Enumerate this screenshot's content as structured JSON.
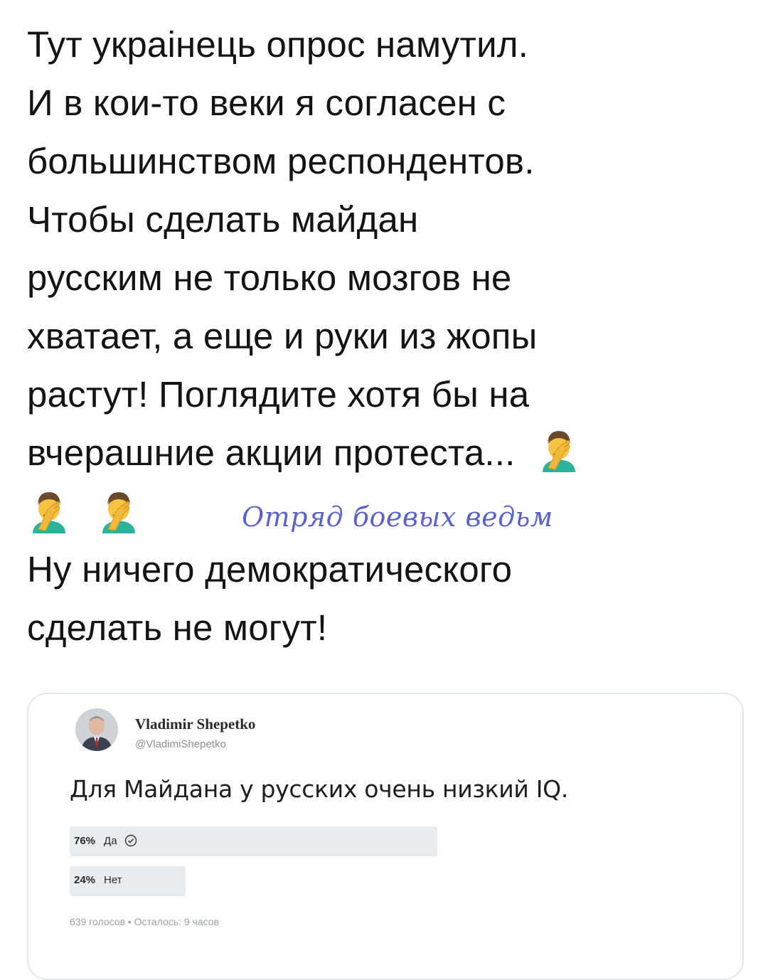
{
  "post": {
    "lines": [
      "Тут украінець опрос намутил.",
      "И в кои-то веки я согласен с",
      "большинством респондентов.",
      "Чтобы сделать майдан",
      "русским не только мозгов не",
      "хватает, а еще и руки из жопы",
      "растут! Поглядите хотя бы на",
      "вчерашние акции протеста..."
    ],
    "closing_lines": [
      "Ну ничего демократического",
      "сделать не могут!"
    ],
    "emoji_name": "facepalm-emoji"
  },
  "watermark": {
    "text": "Отряд боевых ведьм",
    "color": "#5a63c9"
  },
  "tweet": {
    "author_name": "Vladimir Shepetko",
    "author_handle": "@VladimiShepetko",
    "text": "Для Майдана у русских очень низкий  IQ.",
    "poll": {
      "options": [
        {
          "percent_label": "76%",
          "label": "Да",
          "fraction": 0.76,
          "winner": true
        },
        {
          "percent_label": "24%",
          "label": "Нет",
          "fraction": 0.24,
          "winner": false
        }
      ],
      "meta": "639 голосов • Осталось: 9 часов"
    }
  },
  "colors": {
    "poll_bar": "#e6ecf0",
    "card_border": "#e3e6ea"
  }
}
